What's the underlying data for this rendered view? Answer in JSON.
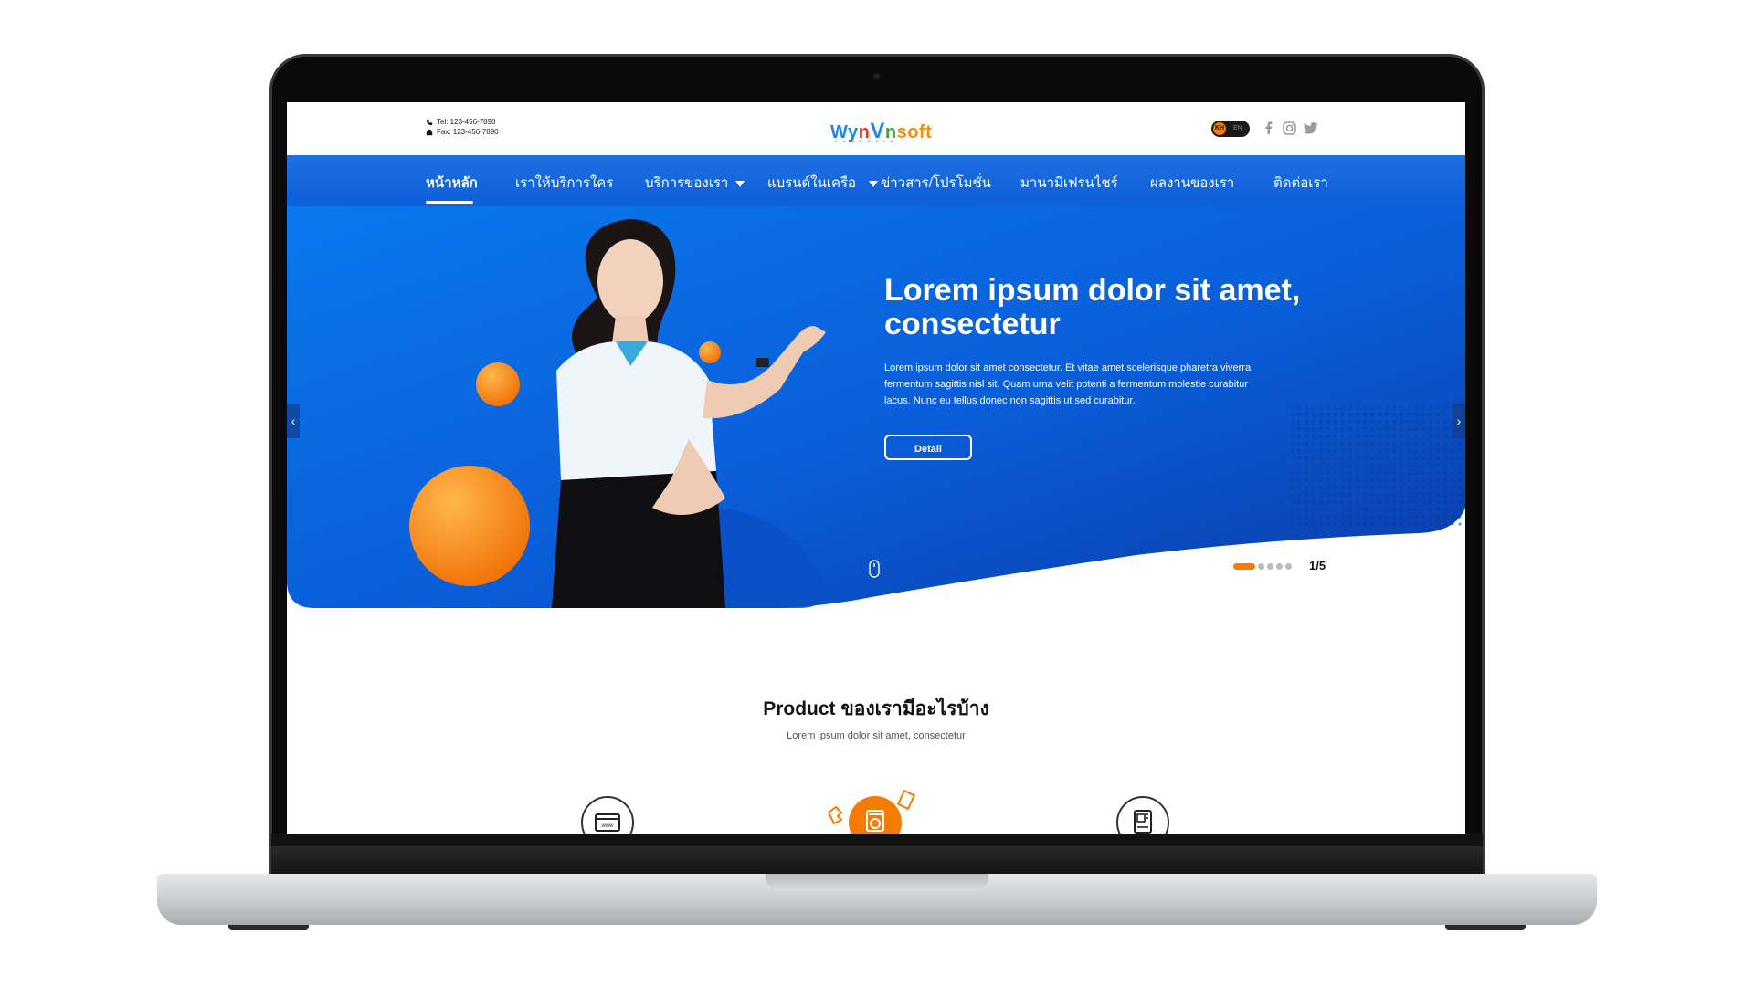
{
  "header": {
    "tel": "Tel: 123-456-7890",
    "fax": "Fax: 123-456-7890",
    "logo": {
      "w": "Wy",
      "n": "n",
      "v": "V",
      "n2": "n",
      "soft": "soft",
      "sub": "CAMBODIA"
    },
    "lang": {
      "kh": "KH",
      "en": "EN"
    }
  },
  "nav": {
    "items": [
      {
        "label": "หน้าหลัก"
      },
      {
        "label": "เราให้บริการใคร"
      },
      {
        "label": "บริการของเรา"
      },
      {
        "label": "แบรนด์ในเครือ"
      },
      {
        "label": "ข่าวสาร/โปรโมชั่น"
      },
      {
        "label": "มานามิเฟรนไชร์"
      },
      {
        "label": "ผลงานของเรา"
      },
      {
        "label": "ติดต่อเรา"
      }
    ]
  },
  "hero": {
    "title": "Lorem ipsum dolor sit amet, consectetur",
    "body": "Lorem ipsum dolor sit amet consectetur. Et vitae amet scelerisque pharetra viverra fermentum sagittis nisl sit. Quam urna velit potenti a fermentum molestie curabitur lacus. Nunc eu tellus donec non sagittis ut sed curabitur.",
    "button": "Detail",
    "counter": "1/5"
  },
  "products": {
    "title": "Product ของเรามีอะไรบ้าง",
    "subtitle": "Lorem ipsum dolor sit amet, consectetur"
  },
  "colors": {
    "brand_blue": "#0d5fdb",
    "accent_orange": "#f57c00"
  }
}
